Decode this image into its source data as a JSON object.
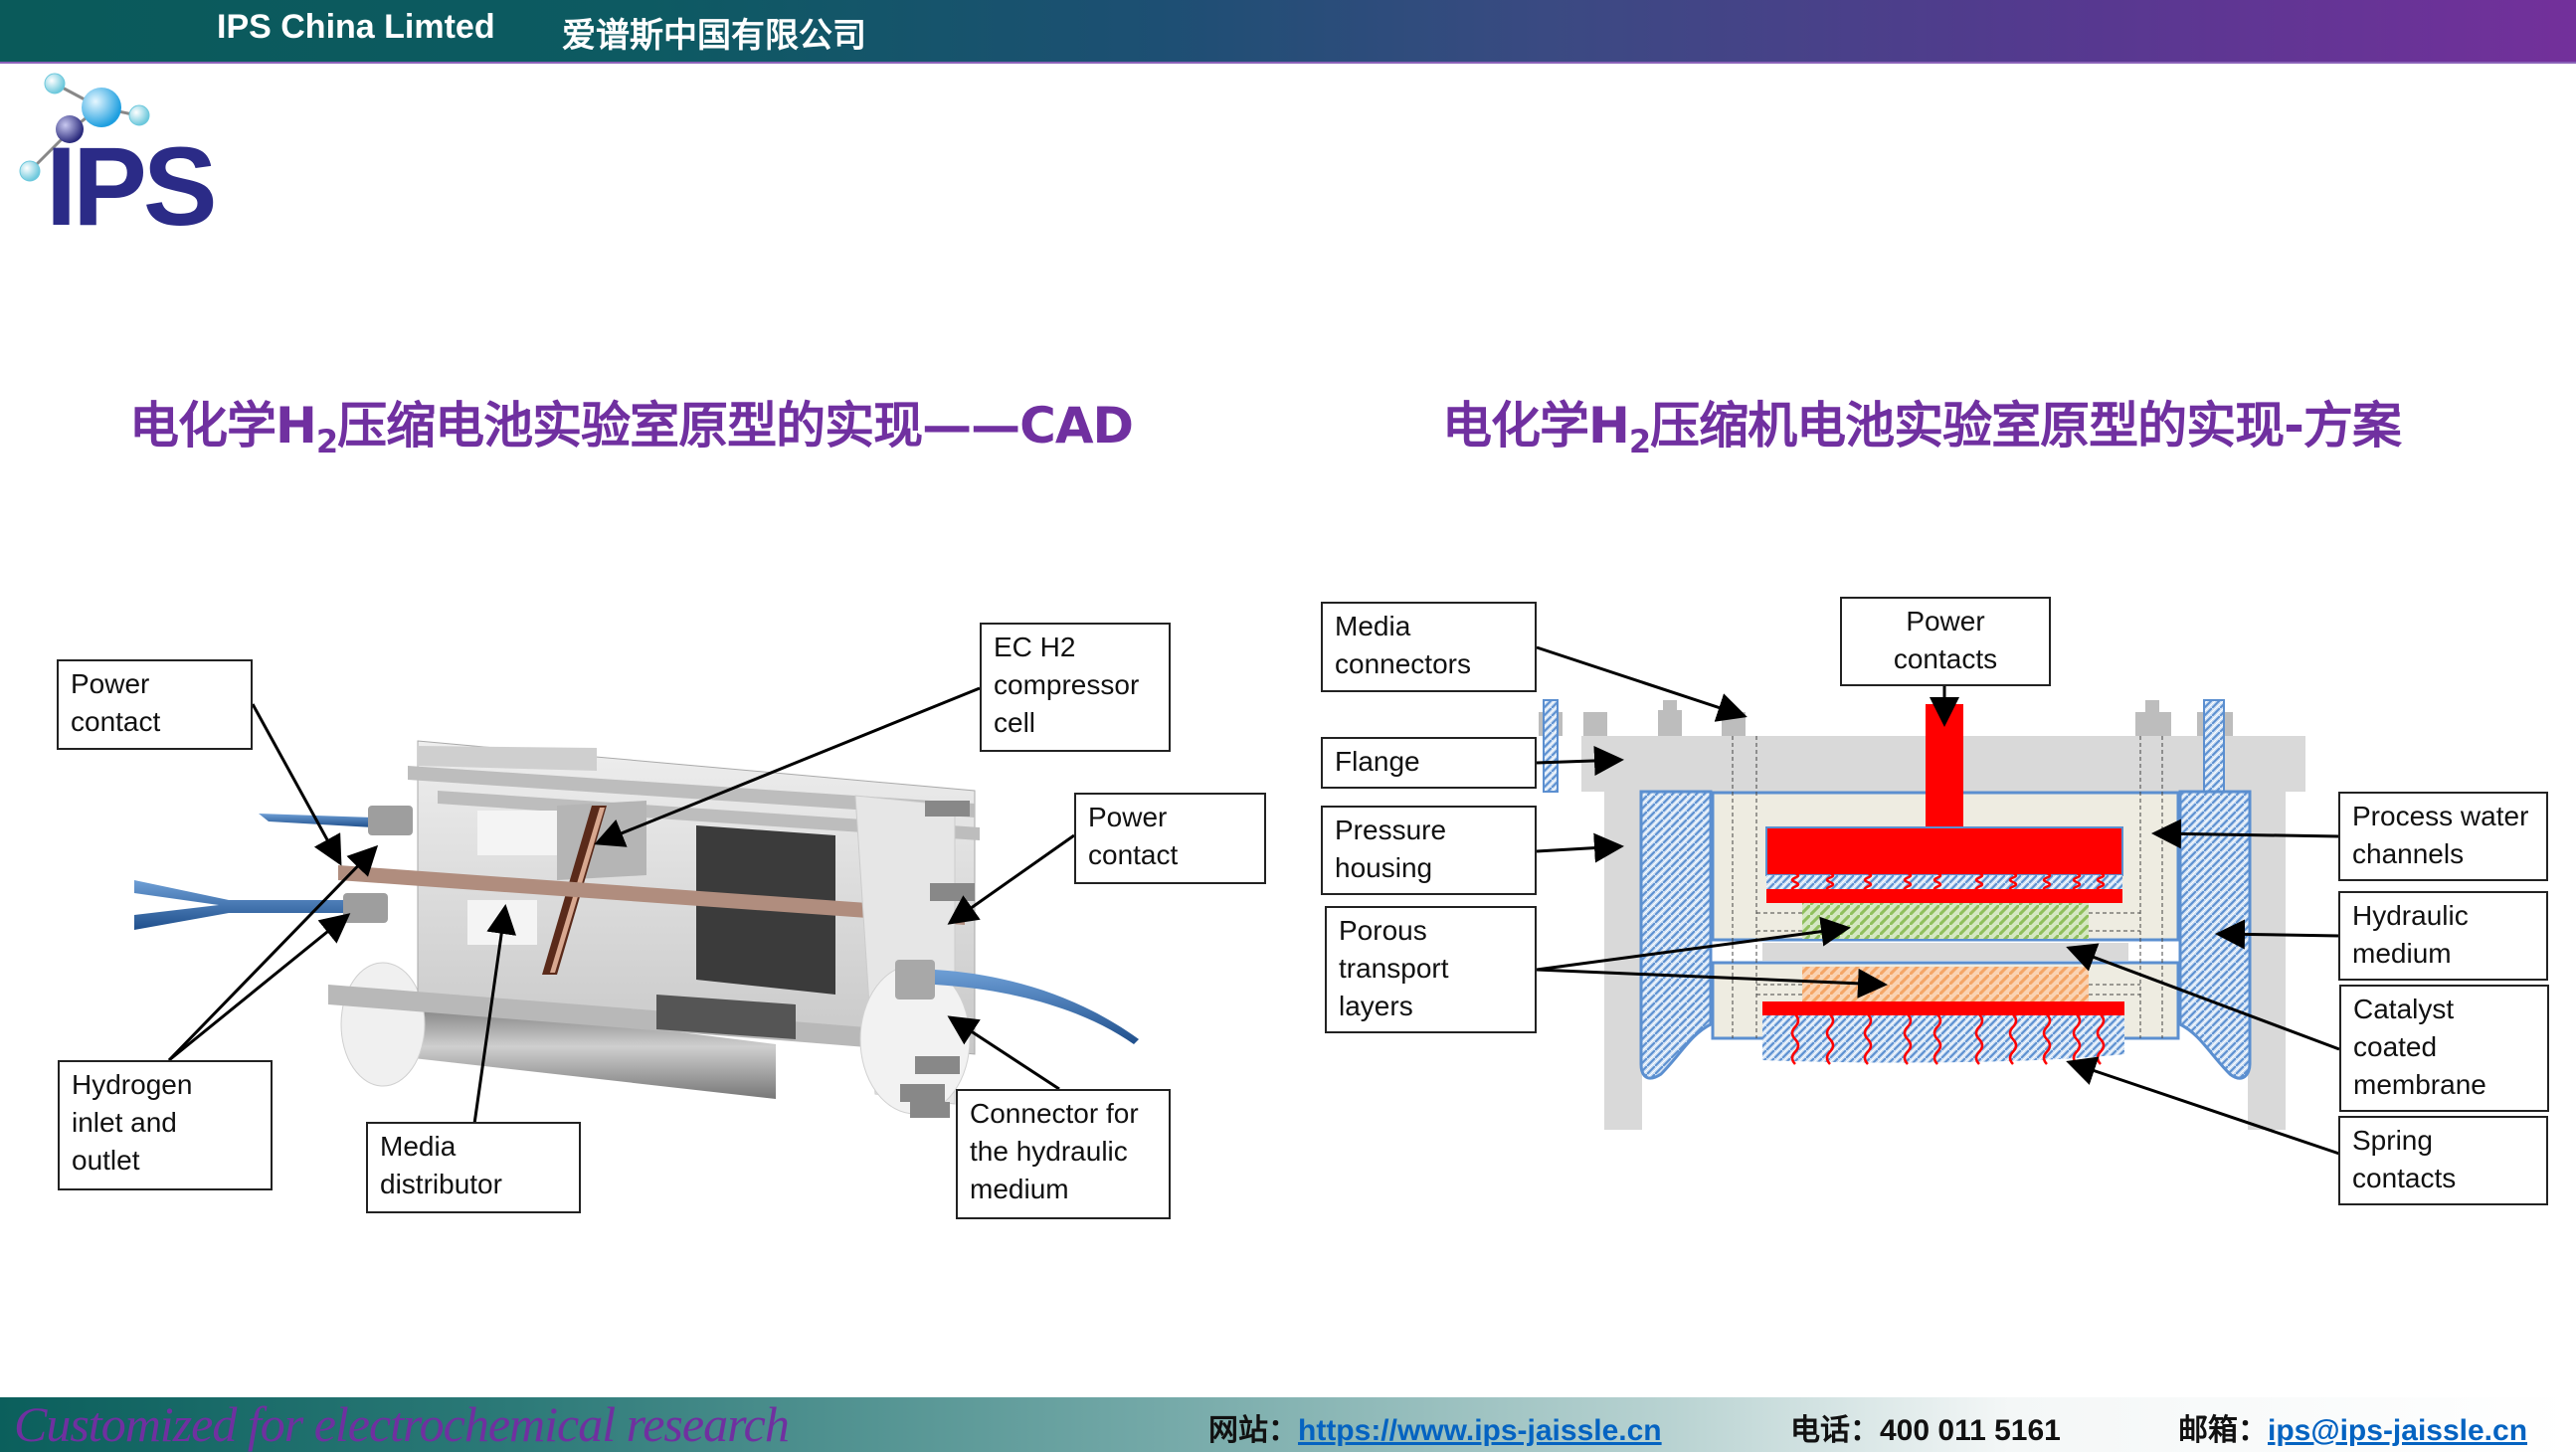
{
  "header": {
    "company_en": "IPS China Limted",
    "company_cn": "爱谱斯中国有限公司"
  },
  "logo": {
    "text": "IPS",
    "icon": "molecule-icon"
  },
  "left_panel": {
    "title_prefix": "电化学H",
    "title_sub": "2",
    "title_suffix": "压缩电池实验室原型的实现——CAD",
    "labels": {
      "power_contact_left": [
        "Power",
        "contact"
      ],
      "ec_h2_cell": [
        "EC H2",
        "compressor",
        "cell"
      ],
      "power_contact_right": [
        "Power",
        "contact"
      ],
      "hydrogen_inlet": [
        "Hydrogen",
        "inlet and",
        "outlet"
      ],
      "media_distributor": [
        "Media",
        "distributor"
      ],
      "hydraulic_connector": [
        "Connector for",
        "the hydraulic",
        "medium"
      ]
    }
  },
  "right_panel": {
    "title_prefix": "电化学H",
    "title_sub": "2",
    "title_suffix": "压缩机电池实验室原型的实现-方案",
    "labels": {
      "media_connectors": [
        "Media",
        "connectors"
      ],
      "power_contacts": [
        "Power",
        "contacts"
      ],
      "flange": [
        "Flange"
      ],
      "pressure_housing": [
        "Pressure",
        "housing"
      ],
      "porous_layers": [
        "Porous",
        "transport",
        "layers"
      ],
      "process_water": [
        "Process water",
        "channels"
      ],
      "hydraulic_medium": [
        "Hydraulic",
        "medium"
      ],
      "catalyst_membrane": [
        "Catalyst",
        "coated",
        "membrane"
      ],
      "spring_contacts": [
        "Spring",
        "contacts"
      ]
    },
    "colors": {
      "power_contact": "#ff0000",
      "hydraulic": "#5b8fd0",
      "anode_ptl": "#a9d18e",
      "cathode_ptl": "#f4b183",
      "flange": "#d9d9d9",
      "housing": "#eeece1"
    }
  },
  "footer": {
    "slogan": "Customized for electrochemical research",
    "website_label": "网站：",
    "website": "https://www.ips-jaissle.cn",
    "phone_label": "电话：",
    "phone": "400 011 5161",
    "email_label": "邮箱：",
    "email": "ips@ips-jaissle.cn"
  }
}
